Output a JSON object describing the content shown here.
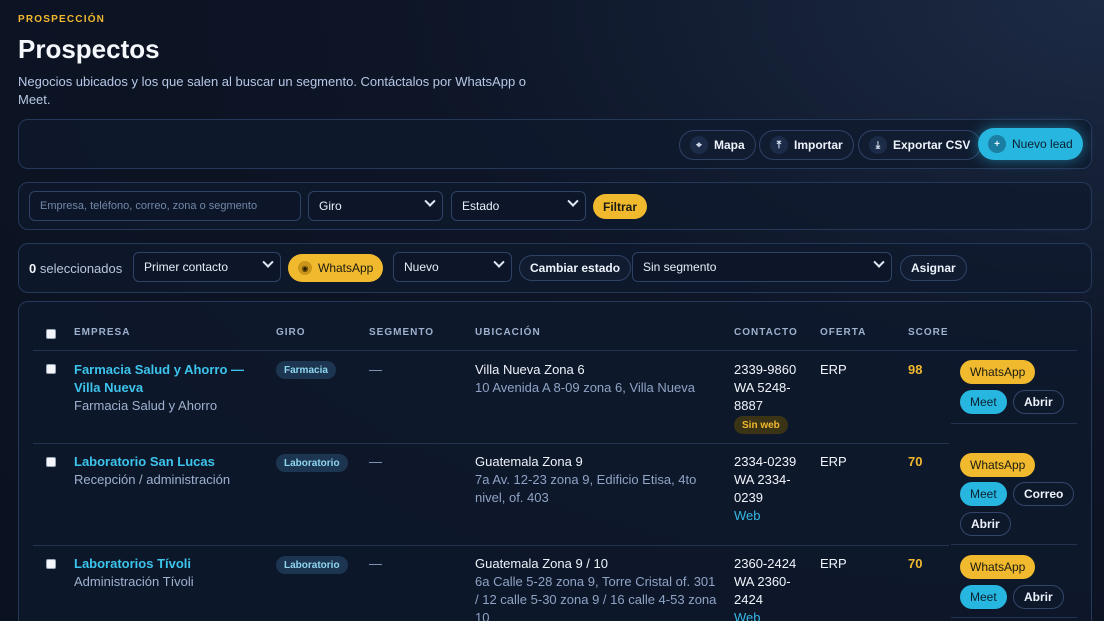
{
  "header": {
    "eyebrow": "PROSPECCIÓN",
    "title": "Prospectos",
    "subtitle": "Negocios ubicados y los que salen al buscar un segmento. Contáctalos por WhatsApp o Meet."
  },
  "toolbar": {
    "map_label": "Mapa",
    "import_label": "Importar",
    "export_label": "Exportar CSV",
    "new_lead_label": "Nuevo lead"
  },
  "filters": {
    "search_placeholder": "Empresa, teléfono, correo, zona o segmento",
    "giro_value": "Giro",
    "estado_value": "Estado",
    "filter_label": "Filtrar"
  },
  "bulk": {
    "selected_count": "0",
    "selected_suffix": "seleccionados",
    "template_value": "Primer contacto",
    "whatsapp_label": "WhatsApp",
    "status_value": "Nuevo",
    "change_status_label": "Cambiar estado",
    "segment_value": "Sin segmento",
    "assign_label": "Asignar"
  },
  "table": {
    "columns": [
      "EMPRESA",
      "GIRO",
      "SEGMENTO",
      "UBICACIÓN",
      "CONTACTO",
      "OFERTA",
      "SCORE"
    ],
    "rows": [
      {
        "company": "Farmacia Salud y Ahorro — Villa Nueva",
        "subtitle": "Farmacia Salud y Ahorro",
        "giro": "Farmacia",
        "segment": "—",
        "location": "Villa Nueva Zona 6",
        "address": "10 Avenida A 8-09 zona 6, Villa Nueva",
        "phone": "2339-9860",
        "wa": "WA 5248-8887",
        "web_badge": "Sin web",
        "offer": "ERP",
        "score": "98",
        "actions": [
          "WhatsApp",
          "Meet",
          "Abrir"
        ]
      },
      {
        "company": "Laboratorio San Lucas",
        "subtitle": "Recepción / administración",
        "giro": "Laboratorio",
        "segment": "—",
        "location": "Guatemala Zona 9",
        "address": "7a Av. 12-23 zona 9, Edificio Etisa, 4to nivel, of. 403",
        "phone": "2334-0239",
        "wa": "WA 2334-0239",
        "web_link": "Web",
        "offer": "ERP",
        "score": "70",
        "actions": [
          "WhatsApp",
          "Meet",
          "Correo",
          "Abrir"
        ]
      },
      {
        "company": "Laboratorios Tívoli",
        "subtitle": "Administración Tívoli",
        "giro": "Laboratorio",
        "segment": "—",
        "location": "Guatemala Zona 9 / 10",
        "address": "6a Calle 5-28 zona 9, Torre Cristal of. 301 / 12 calle 5-30 zona 9 / 16 calle 4-53 zona 10",
        "phone": "2360-2424",
        "wa": "WA 2360-2424",
        "web_link": "Web",
        "offer": "ERP",
        "score": "70",
        "actions": [
          "WhatsApp",
          "Meet",
          "Abrir"
        ]
      }
    ]
  },
  "icons": {
    "map": "map-pin-icon",
    "import": "upload-icon",
    "export": "download-icon",
    "new_lead": "plus-icon",
    "whatsapp": "whatsapp-icon",
    "dropdown": "chevron-down-icon"
  },
  "colors": {
    "accent_yellow": "#f1ba2e",
    "accent_cyan": "#27b6df",
    "link": "#3cc4ec",
    "background": "#0d1526"
  }
}
